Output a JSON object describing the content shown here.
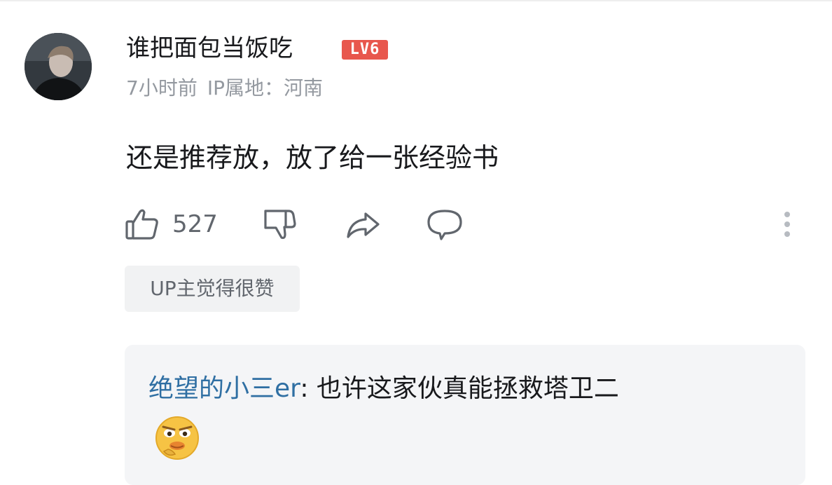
{
  "comment": {
    "username": "谁把面包当饭吃",
    "level": "LV6",
    "time": "7小时前",
    "ip_location": "IP属地：河南",
    "text": "还是推荐放，放了给一张经验书",
    "likes": "527",
    "up_badge": "UP主觉得很赞"
  },
  "icons": {
    "like": "thumbs-up-icon",
    "dislike": "thumbs-down-icon",
    "share": "share-icon",
    "reply": "comment-icon",
    "more": "more-vertical-icon"
  },
  "reply": {
    "author": "绝望的小三er",
    "separator": ": ",
    "text": "也许这家伙真能拯救塔卫二",
    "emoji": "smirk-emoji"
  },
  "colors": {
    "level_badge": "#e8574d",
    "reply_author": "#2f6fa3",
    "secondary_text": "#9499a0"
  }
}
